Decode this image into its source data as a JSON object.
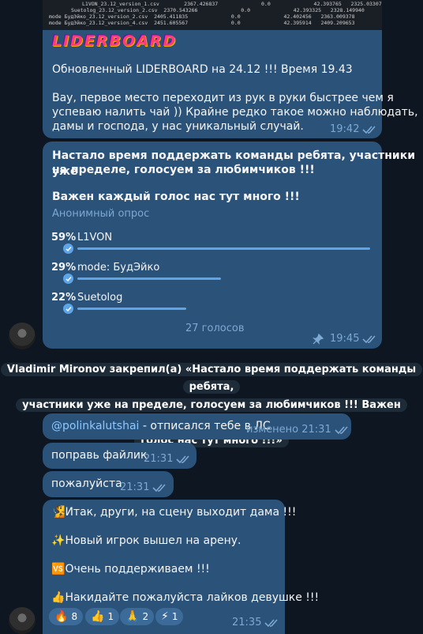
{
  "image_table": [
    {
      "name": "L1VON_23.12_version_1.csv",
      "v1": "2367.426837",
      "v2": "0.0",
      "v3": "42.393765",
      "v4": "2325.033072"
    },
    {
      "name": "Suetolog_23.12_version_2.csv",
      "v1": "2370.543266",
      "v2": "0.0",
      "v3": "42.393325",
      "v4": "2328.149940"
    },
    {
      "name": "mode БудЭйко_23.12_version_2.csv",
      "v1": "2405.411835",
      "v2": "0.0",
      "v3": "42.402456",
      "v4": "2363.009378"
    },
    {
      "name": "mode БудЭйко_23.12_version_4.csv",
      "v1": "2451.605567",
      "v2": "0.0",
      "v3": "42.395914",
      "v4": "2409.209653"
    }
  ],
  "logo_text": "LIDERBOARD",
  "msg1": {
    "line1": "Обновленный LIDERBOARD на 24.12 !!! Время 19.43",
    "para2_l1": "Вау, первое место переходит из рук в руки быстрее чем я",
    "para2_l2": "успеваю налить чай )) Крайне редко такое можно наблюдать,",
    "para2_l3": "дамы и господа, у нас уникальный случай.",
    "time": "19:42"
  },
  "poll": {
    "q_l1": "Настало время поддержать команды ребята, участники уже",
    "q_l2": "на пределе, голосуем за любимчиков !!!",
    "q_l3": "Важен каждый голос нас тут много !!!",
    "type": "Анонимный опрос",
    "options": [
      {
        "pct": "59%",
        "label": "L1VON",
        "fraction": 0.59
      },
      {
        "pct": "29%",
        "label": "mode: БудЭйко",
        "fraction": 0.29
      },
      {
        "pct": "22%",
        "label": "Suetolog",
        "fraction": 0.22
      }
    ],
    "votes": "27 голосов",
    "time": "19:45"
  },
  "service": {
    "l1": "Vladimir Mironov закрепил(а) «Настало время поддержать команды ребята,",
    "l2": "участники уже на пределе, голосуем за любимчиков !!!  Важен каждый",
    "l3": "голос нас тут много !!!»"
  },
  "msg2": {
    "mention": "@polinkalutshai",
    "text": " - отписался тебе в ЛС",
    "edited": "изменено 21:31"
  },
  "msg3": {
    "text": "поправь файлик",
    "time": "21:31"
  },
  "msg4": {
    "text": "пожалуйста",
    "time": "21:31"
  },
  "msg5": {
    "l1": "Итак, други, на сцену выходит дама !!!",
    "l2": "Новый игрок вышел на арену.",
    "l3": "Очень поддерживаем !!!",
    "l4": "Накидайте пожалуйста лайков девушке !!!",
    "e1": "🧏",
    "e2": "✨",
    "e3": "🆚",
    "e4": "👍",
    "time": "21:35",
    "reactions": [
      {
        "emoji": "🔥",
        "count": "8"
      },
      {
        "emoji": "👍",
        "count": "1"
      },
      {
        "emoji": "🙏",
        "count": "2"
      },
      {
        "emoji": "⚡",
        "count": "1"
      }
    ]
  },
  "colors": {
    "bubble": "#2b5278",
    "background": "#0e1621",
    "accent": "#5ea5e8",
    "meta": "#7da8d3"
  }
}
